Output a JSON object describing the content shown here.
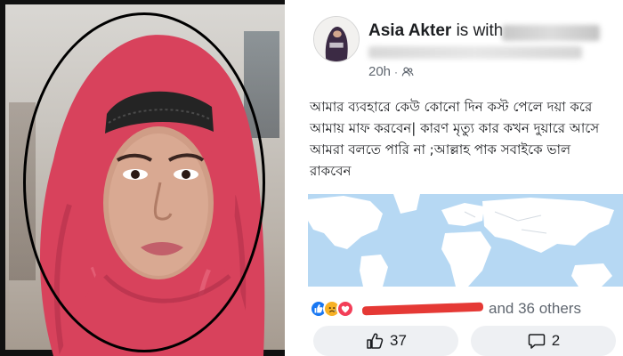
{
  "post": {
    "author_name": "Asia Akter",
    "with_text": "is with",
    "time": "20h",
    "privacy_icon": "friends-icon",
    "body_text": "আমার  ব্যবহারে কেউ  কোনো দিন কস্ট পেলে দয়া করে\nআমায় মাফ করবেন| কারণ মৃত্যু কার কখন দুয়ারে আসে\nআমরা বলতে পারি না ;আল্লাহ  পাক  সবাইকে ভাল\nরাকবেন",
    "attachment": "world-map"
  },
  "reactions": {
    "icons": [
      "like-reaction-icon",
      "sad-reaction-icon",
      "love-reaction-icon"
    ],
    "others_text": "and 36 others"
  },
  "actions": {
    "like_count": "37",
    "comment_count": "2"
  },
  "colors": {
    "hijab": "#d8425c",
    "like_blue": "#1877f2",
    "love_red": "#f33e58",
    "sad_yellow": "#f7b125",
    "map_ocean": "#b6d8f3",
    "map_land": "#ffffff",
    "redaction": "#e53935"
  }
}
